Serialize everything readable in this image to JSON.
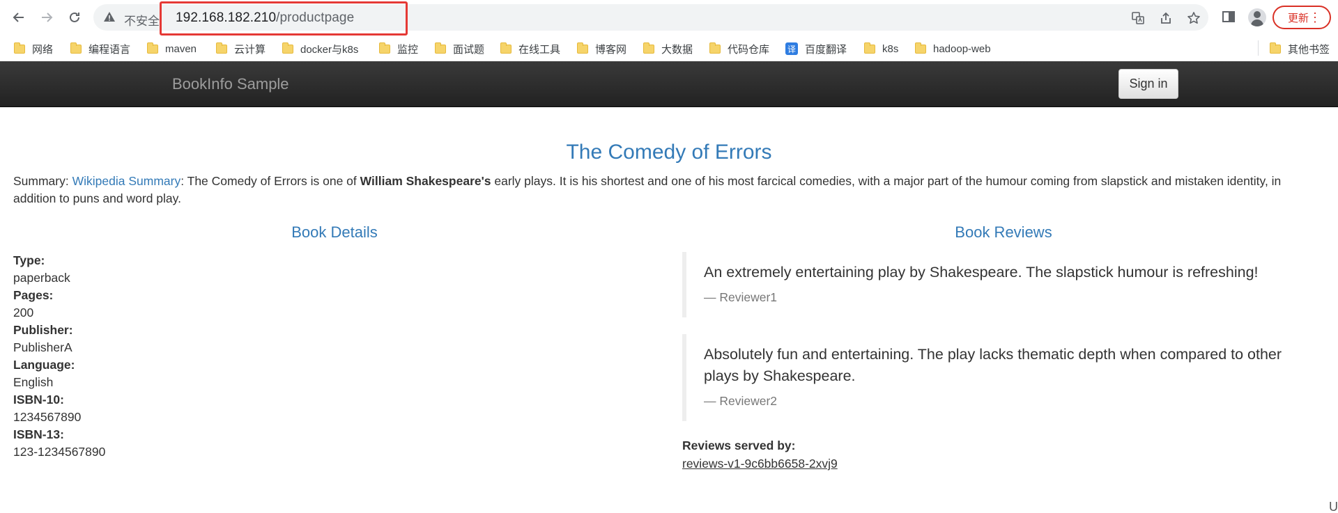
{
  "browser": {
    "insecure_label": "不安全",
    "url_host": "192.168.182.210",
    "url_path": "/productpage",
    "update_label": "更新",
    "menu_glyph": "⋮",
    "highlight_color": "#e53935"
  },
  "bookmarks": [
    {
      "label": "网络",
      "icon": "folder-icon"
    },
    {
      "label": "编程语言",
      "icon": "folder-icon"
    },
    {
      "label": "maven",
      "icon": "folder-icon"
    },
    {
      "label": "云计算",
      "icon": "folder-icon"
    },
    {
      "label": "docker与k8s",
      "icon": "folder-icon"
    },
    {
      "label": "监控",
      "icon": "folder-icon"
    },
    {
      "label": "面试题",
      "icon": "folder-icon"
    },
    {
      "label": "在线工具",
      "icon": "folder-icon"
    },
    {
      "label": "博客网",
      "icon": "folder-icon"
    },
    {
      "label": "大数据",
      "icon": "folder-icon"
    },
    {
      "label": "代码仓库",
      "icon": "folder-icon"
    },
    {
      "label": "百度翻译",
      "icon": "translate-icon",
      "icon_text": "译"
    },
    {
      "label": "k8s",
      "icon": "folder-icon"
    },
    {
      "label": "hadoop-web",
      "icon": "folder-icon"
    }
  ],
  "other_bookmarks": "其他书签",
  "app": {
    "brand": "BookInfo Sample",
    "signin": "Sign in"
  },
  "book": {
    "title": "The Comedy of Errors",
    "summary_prefix": "Summary: ",
    "summary_link": "Wikipedia Summary",
    "summary_part1": ": The Comedy of Errors is one of ",
    "summary_bold": "William Shakespeare's",
    "summary_part2": " early plays. It is his shortest and one of his most farcical comedies, with a major part of the humour coming from slapstick and mistaken identity, in addition to puns and word play."
  },
  "details": {
    "heading": "Book Details",
    "type_label": "Type:",
    "type_value": "paperback",
    "pages_label": "Pages:",
    "pages_value": "200",
    "publisher_label": "Publisher:",
    "publisher_value": "PublisherA",
    "language_label": "Language:",
    "language_value": "English",
    "isbn10_label": "ISBN-10:",
    "isbn10_value": "1234567890",
    "isbn13_label": "ISBN-13:",
    "isbn13_value": "123-1234567890"
  },
  "reviews": {
    "heading": "Book Reviews",
    "items": [
      {
        "text": "An extremely entertaining play by Shakespeare. The slapstick humour is refreshing!",
        "author": "— Reviewer1"
      },
      {
        "text": "Absolutely fun and entertaining. The play lacks thematic depth when compared to other plays by Shakespeare.",
        "author": "— Reviewer2"
      }
    ],
    "served_label": "Reviews served by:",
    "served_value": "reviews-v1-9c6bb6658-2xvj9"
  },
  "corner_glyph": "U",
  "colors": {
    "link": "#337ab7",
    "navbar": "#222222",
    "brand": "#9d9d9d"
  }
}
